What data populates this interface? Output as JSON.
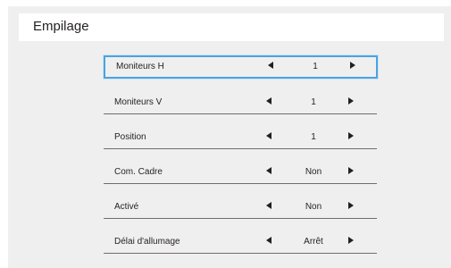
{
  "menu": {
    "title": "Empilage",
    "items": [
      {
        "label": "Moniteurs H",
        "value": "1"
      },
      {
        "label": "Moniteurs V",
        "value": "1"
      },
      {
        "label": "Position",
        "value": "1"
      },
      {
        "label": "Com. Cadre",
        "value": "Non"
      },
      {
        "label": "Activé",
        "value": "Non"
      },
      {
        "label": "Délai d'allumage",
        "value": "Arrêt"
      }
    ]
  },
  "colors": {
    "background": "#f0efef",
    "selection": "#4aa3df",
    "text": "#231f20"
  }
}
